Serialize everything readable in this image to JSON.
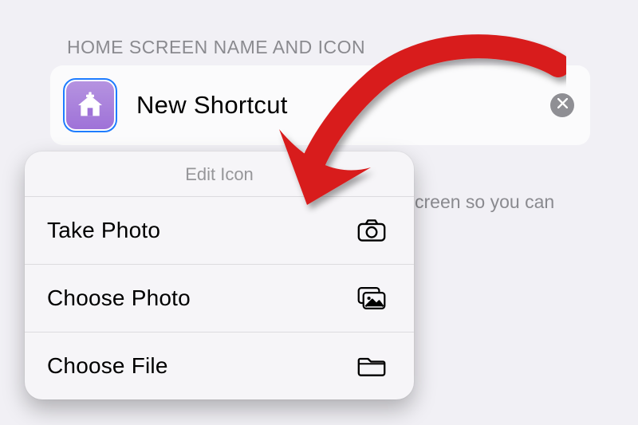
{
  "section": {
    "header": "HOME SCREEN NAME AND ICON",
    "shortcut_name": "New Shortcut",
    "hint_visible_fragment": "creen so you can"
  },
  "popup": {
    "title": "Edit Icon",
    "items": [
      {
        "label": "Take Photo",
        "icon": "camera-icon"
      },
      {
        "label": "Choose Photo",
        "icon": "photo-stack-icon"
      },
      {
        "label": "Choose File",
        "icon": "folder-icon"
      }
    ]
  },
  "annotation": {
    "arrow_color": "#d81d1d"
  }
}
